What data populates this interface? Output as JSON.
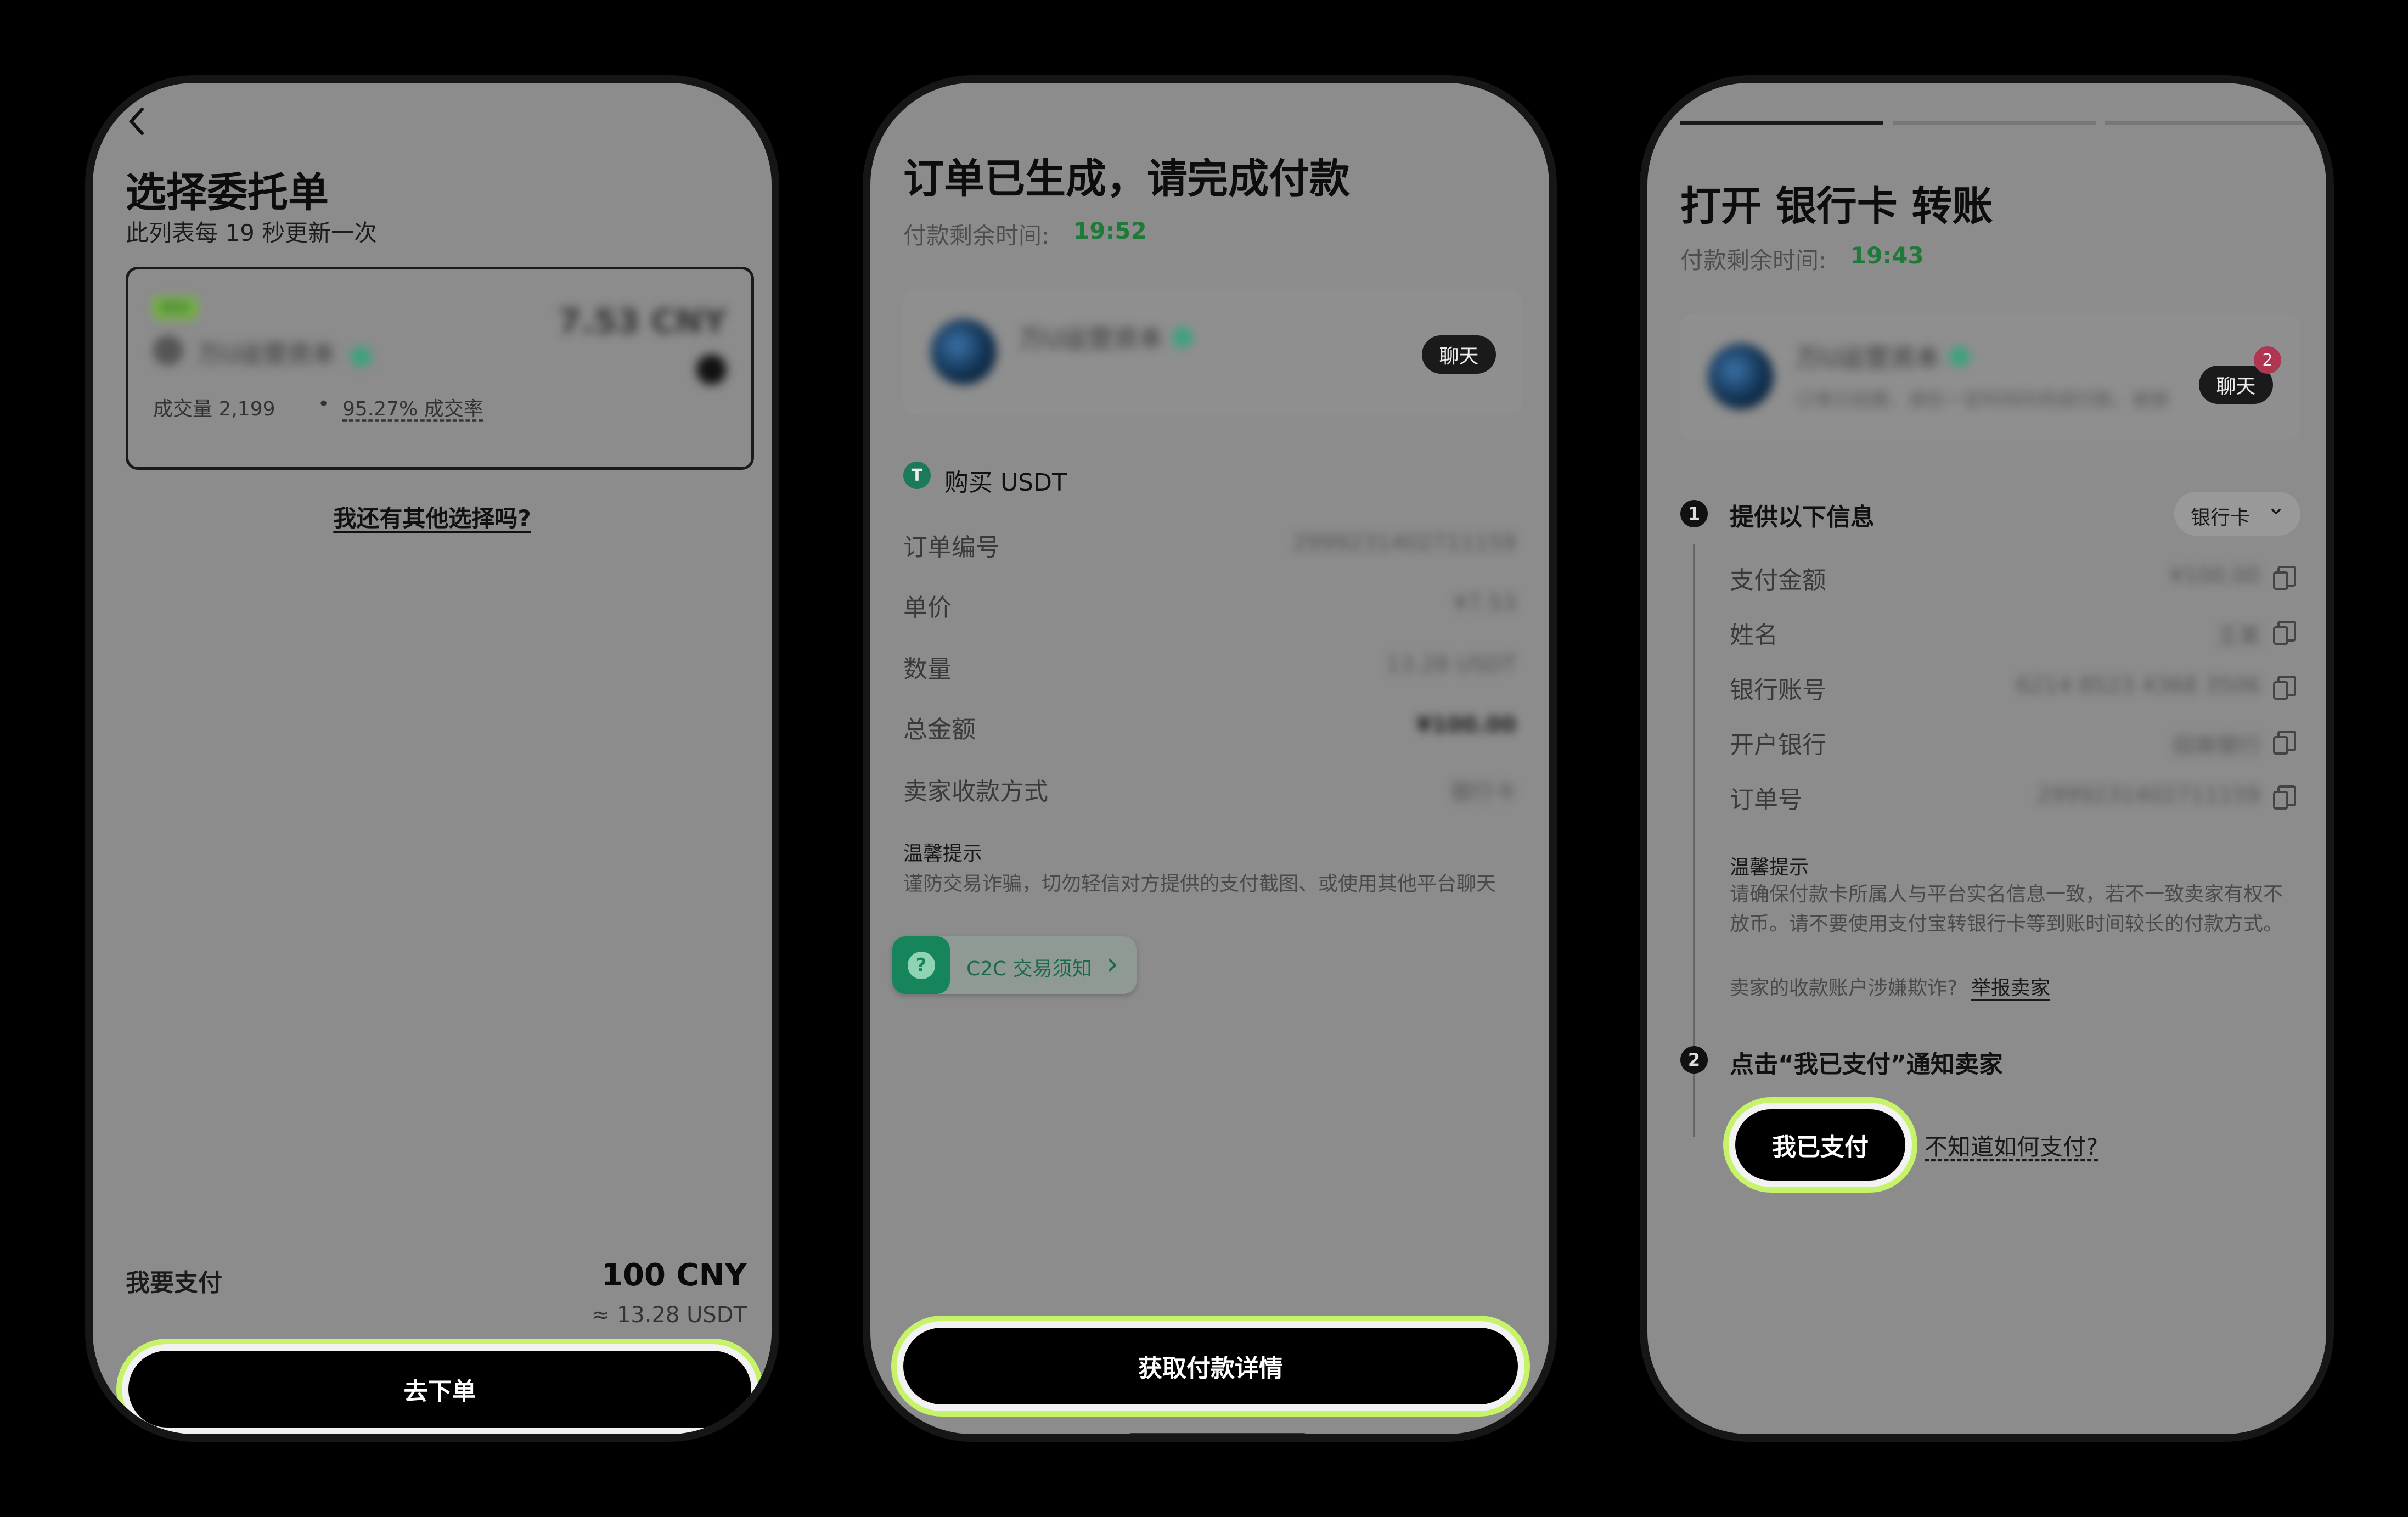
{
  "screen1": {
    "title": "选择委托单",
    "subtitle": "此列表每 19 秒更新一次",
    "offer": {
      "tag": "NEW",
      "merchant": "万U运营资本",
      "price": "7.53 CNY",
      "volume_label": "成交量 2,199",
      "dot": "•",
      "rate": "95.27% 成交率"
    },
    "other_options_link": "我还有其他选择吗?",
    "pay_label": "我要支付",
    "pay_amount": "100 CNY",
    "pay_usdt": "≈ 13.28 USDT",
    "place_order_button": "去下单"
  },
  "screen2": {
    "title": "订单已生成，请完成付款",
    "time_label": "付款剩余时间:",
    "time_value": "19:52",
    "merchant": "万U运营资本",
    "chat_button": "聊天",
    "buy_icon_glyph": "T",
    "buy_label": "购买 USDT",
    "rows": [
      {
        "label": "订单编号",
        "value": "2999231402711159"
      },
      {
        "label": "单价",
        "value": "¥7.53"
      },
      {
        "label": "数量",
        "value": "13.28 USDT"
      },
      {
        "label": "总金额",
        "value": "¥100.00"
      },
      {
        "label": "卖家收款方式",
        "value": "银行卡"
      }
    ],
    "tip_title": "温馨提示",
    "tip_body": "谨防交易诈骗，切勿轻信对方提供的支付截图、或使用其他平台聊天",
    "c2c_icon_glyph": "?",
    "c2c_notice": "C2C 交易须知",
    "c2c_chevron": "›",
    "get_details_button": "获取付款详情"
  },
  "screen3": {
    "title": "打开 银行卡 转账",
    "time_label": "付款剩余时间:",
    "time_value": "19:43",
    "merchant": "万U运营资本",
    "merchant_sub": "订单已创建，请在一定时间内完成付款，谢谢",
    "chat_button": "聊天",
    "chat_badge": "2",
    "step1_num": "1",
    "step1_title": "提供以下信息",
    "method_dropdown": "银行卡",
    "method_chevron": "⌄",
    "rows": [
      {
        "label": "支付金额",
        "value": "¥100.00"
      },
      {
        "label": "姓名",
        "value": "王某"
      },
      {
        "label": "银行账号",
        "value": "6214 8523 4368 3506"
      },
      {
        "label": "开户银行",
        "value": "招商银行"
      },
      {
        "label": "订单号",
        "value": "2999231402711159"
      }
    ],
    "tip_title": "温馨提示",
    "tip_body": "请确保付款卡所属人与平台实名信息一致，若不一致卖家有权不放币。请不要使用支付宝转银行卡等到账时间较长的付款方式。",
    "fraud_q": "卖家的收款账户涉嫌欺诈?",
    "report_link": "举报卖家",
    "step2_num": "2",
    "step2_title": "点击“我已支付”通知卖家",
    "paid_button": "我已支付",
    "how_to_pay_link": "不知道如何支付?"
  },
  "colors": {
    "accent_glow": "#c7f36a",
    "timer_green": "#1f7a3a",
    "screen_overlay": "#8c8c8c"
  }
}
